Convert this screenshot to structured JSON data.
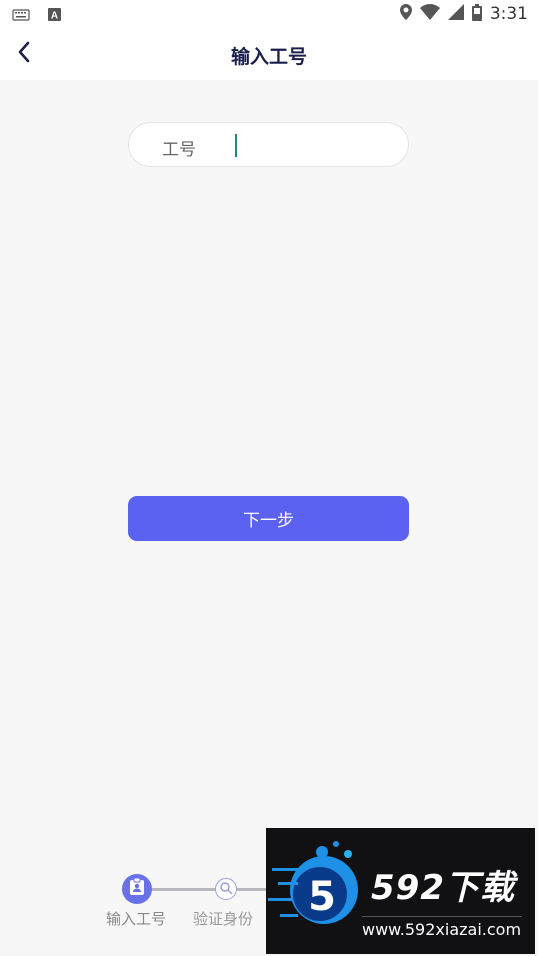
{
  "status_bar": {
    "time": "3:31",
    "icons": [
      "keyboard-icon",
      "font-notification-icon",
      "location-icon",
      "wifi-icon",
      "signal-icon",
      "battery-icon"
    ]
  },
  "header": {
    "title": "输入工号",
    "back_icon": "chevron-left-icon"
  },
  "form": {
    "field_label": "工号",
    "field_value": "",
    "field_placeholder": ""
  },
  "actions": {
    "next_label": "下一步"
  },
  "steps": [
    {
      "label": "输入工号",
      "icon": "id-badge-icon",
      "active": true
    },
    {
      "label": "验证身份",
      "icon": "search-icon",
      "active": false
    }
  ],
  "watermark": {
    "brand": "592下载",
    "url": "www.592xiazai.com",
    "logo_digit": "5"
  },
  "colors": {
    "accent": "#5b62f2",
    "title": "#1a1f4d",
    "background": "#f7f7f8",
    "caret": "#1a8a7a"
  }
}
